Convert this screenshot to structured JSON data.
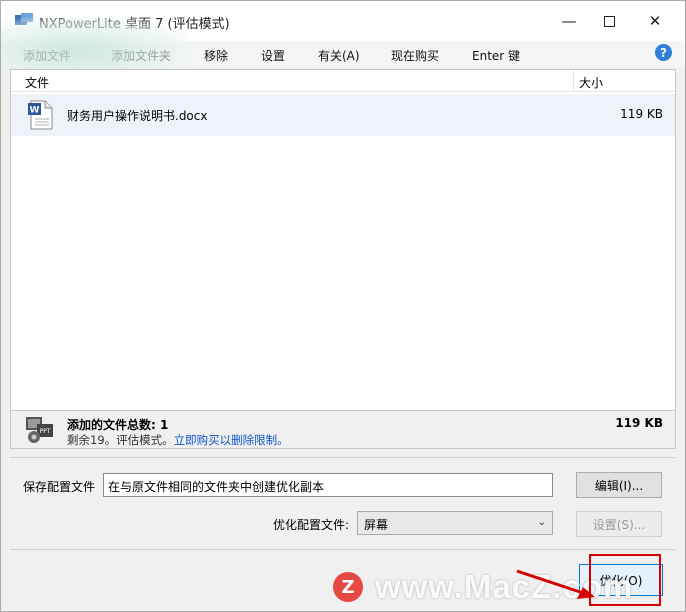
{
  "window": {
    "title": "NXPowerLite 桌面 7 (评估模式)",
    "controls": {
      "minimize": "—",
      "maximize": "",
      "close": "✕"
    }
  },
  "menu": {
    "items": [
      {
        "id": "add-file",
        "label": "添加文件"
      },
      {
        "id": "add-folder",
        "label": "添加文件夹"
      },
      {
        "id": "remove",
        "label": "移除"
      },
      {
        "id": "settings",
        "label": "设置"
      },
      {
        "id": "about",
        "label": "有关(A)"
      },
      {
        "id": "buy",
        "label": "现在购买"
      },
      {
        "id": "enter-key",
        "label": "Enter 键"
      }
    ],
    "help": "?"
  },
  "file_list": {
    "columns": {
      "name": "文件",
      "size": "大小"
    },
    "rows": [
      {
        "name": "财务用户操作说明书.docx",
        "size": "119 KB",
        "icon": "word-document-icon"
      }
    ]
  },
  "summary": {
    "title": "添加的文件总数: 1",
    "remaining": "剩余19。评估模式。",
    "link": "立即购买以删除限制。",
    "total_size": "119 KB"
  },
  "settings": {
    "save_profile_label": "保存配置文件",
    "save_profile_value": "在与原文件相同的文件夹中创建优化副本",
    "edit_button": "编辑(I)...",
    "optimize_profile_label": "优化配置文件:",
    "optimize_profile_value": "屏幕",
    "settings_button": "设置(S)...",
    "optimize_button": "优化(O)"
  },
  "watermark": {
    "logo": "Z",
    "text": "www.MacZ.com"
  },
  "colors": {
    "accent": "#0078d7",
    "highlight": "#d40000",
    "link": "#0a55c8",
    "watermark_logo": "#e8403a"
  }
}
